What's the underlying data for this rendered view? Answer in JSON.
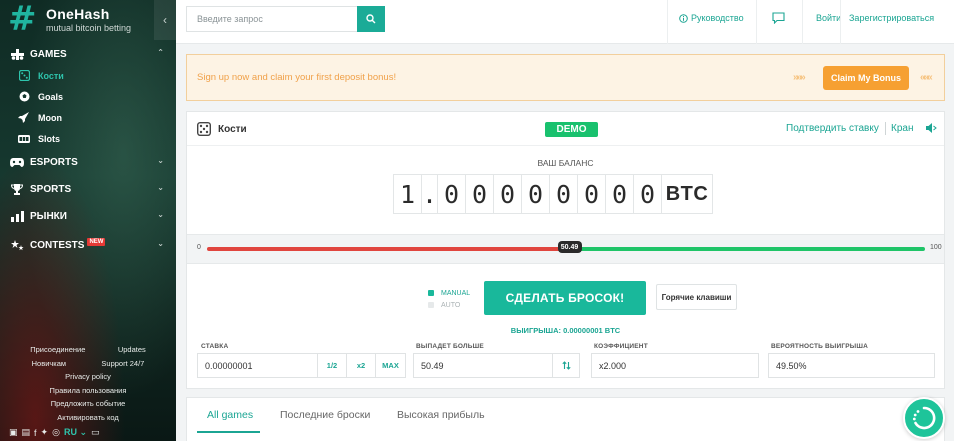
{
  "brand": {
    "title": "OneHash",
    "subtitle": "mutual bitcoin betting"
  },
  "sidebar": {
    "sections": [
      {
        "label": "GAMES",
        "icon": "gamepad-icon",
        "expanded": true
      },
      {
        "label": "ESPORTS",
        "icon": "controller-icon"
      },
      {
        "label": "SPORTS",
        "icon": "trophy-icon"
      },
      {
        "label": "РЫНКИ",
        "icon": "chart-icon"
      },
      {
        "label": "CONTESTS",
        "icon": "stars-icon",
        "badge": "NEW"
      }
    ],
    "games": [
      {
        "label": "Кости",
        "icon": "dice-icon",
        "active": true
      },
      {
        "label": "Goals",
        "icon": "ball-icon"
      },
      {
        "label": "Moon",
        "icon": "rocket-icon"
      },
      {
        "label": "Slots",
        "icon": "slots-icon"
      }
    ],
    "footer": {
      "row1": [
        "Присоединение",
        "Updates"
      ],
      "row2": [
        "Новичкам",
        "Support 24/7"
      ],
      "links": [
        "Privacy policy",
        "Правила пользования",
        "Предложить событие",
        "Активировать код"
      ]
    },
    "lang": "RU"
  },
  "topbar": {
    "search_placeholder": "Введите запрос",
    "guide": "Руководство",
    "login": "Войти",
    "register": "Зарегистрироваться"
  },
  "banner": {
    "text": "Sign up now and claim your first deposit bonus!",
    "button": "Claim My Bonus",
    "arrows_left": "»»»",
    "arrows_right": "«««"
  },
  "dice": {
    "title": "Кости",
    "demo": "DEMO",
    "verify": "Подтвердить ставку",
    "faucet": "Кран",
    "balance_label": "ВАШ БАЛАНС",
    "balance_digits": [
      "1",
      ".",
      "0",
      "0",
      "0",
      "0",
      "0",
      "0",
      "0",
      "0"
    ],
    "balance_unit": "BTC",
    "slider": {
      "min": "0",
      "max": "100",
      "value": "50.49",
      "fraction": 0.5049
    },
    "mode_manual": "MANUAL",
    "mode_auto": "AUTO",
    "roll_button": "СДЕЛАТЬ БРОСОК!",
    "hotkeys": "Горячие клавиши",
    "win_label": "ВЫИГРЫША: 0.00000001 BTC",
    "bet": {
      "label": "СТАВКА",
      "value": "0.00000001",
      "half": "1/2",
      "double": "x2",
      "max": "MAX"
    },
    "roll_over": {
      "label": "ВЫПАДЕТ БОЛЬШЕ",
      "value": "50.49"
    },
    "multiplier": {
      "label": "КОЭФФИЦИЕНТ",
      "value": "x2.000"
    },
    "chance": {
      "label": "ВЕРОЯТНОСТЬ ВЫИГРЫША",
      "value": "49.50%"
    }
  },
  "tabs": [
    {
      "label": "All games",
      "active": true
    },
    {
      "label": "Последние броски"
    },
    {
      "label": "Высокая прибыль"
    }
  ],
  "colors": {
    "accent": "#1ba593",
    "demo": "#19c16e",
    "bonus": "#f6a032",
    "red": "#e0453e",
    "green": "#1fc468"
  }
}
